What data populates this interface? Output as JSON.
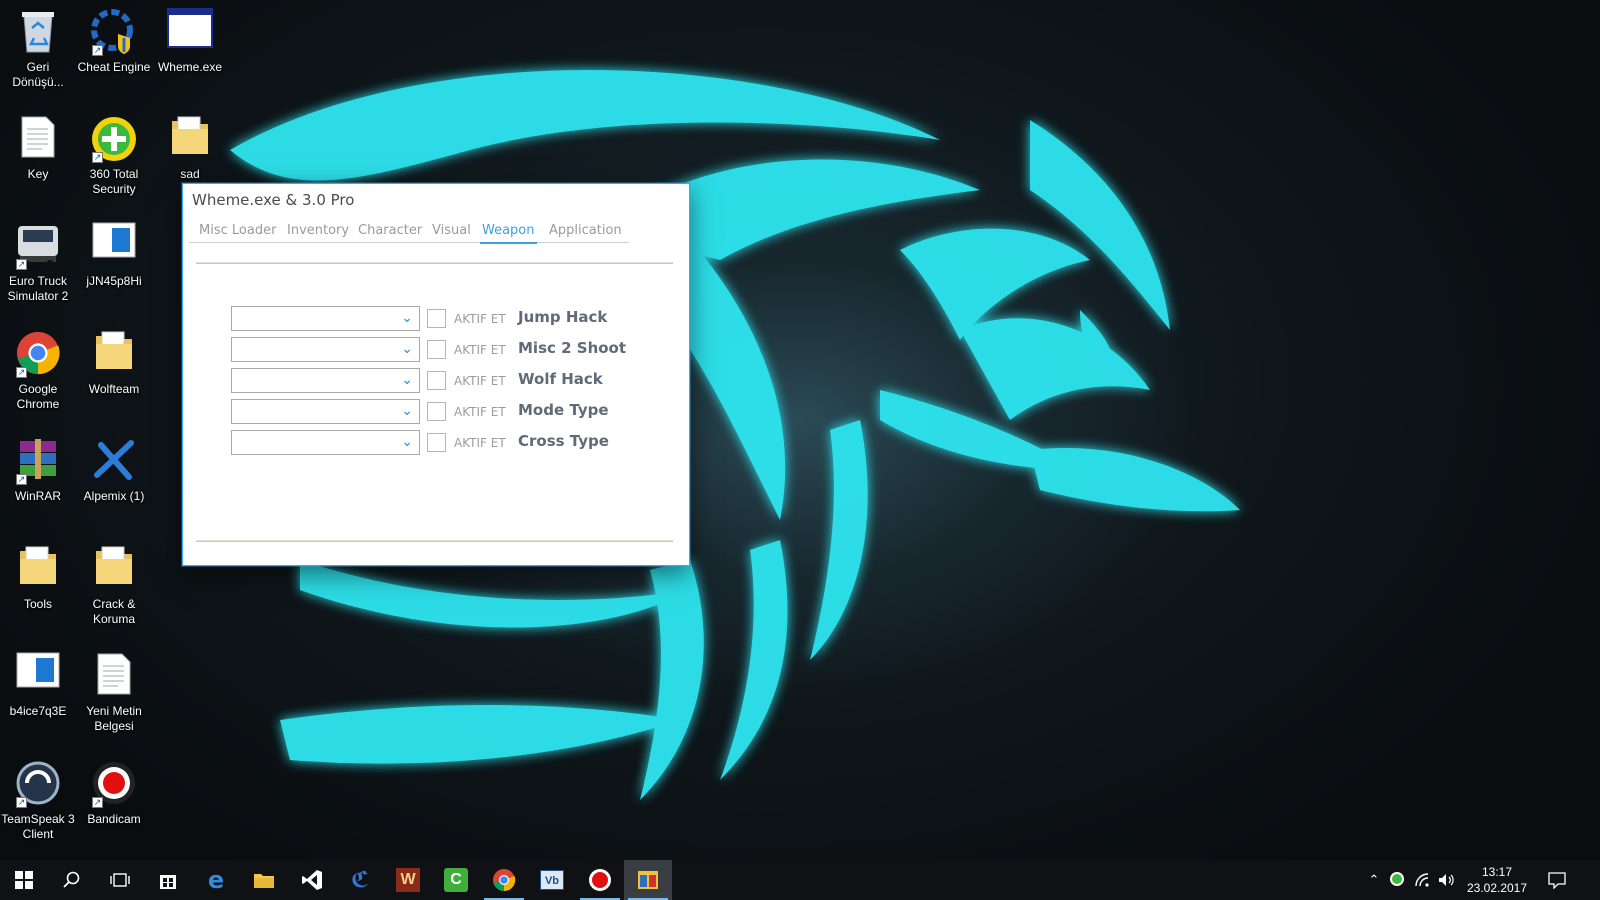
{
  "desktop": {
    "icons": [
      {
        "label": "Geri Dönüşü...",
        "icon": "recycle-bin"
      },
      {
        "label": "Cheat Engine",
        "icon": "cheat-engine"
      },
      {
        "label": "Wheme.exe",
        "icon": "window-app"
      },
      {
        "label": "Key",
        "icon": "text-document"
      },
      {
        "label": "360 Total Security",
        "icon": "360-security"
      },
      {
        "label": "sad",
        "icon": "folder"
      },
      {
        "label": "Euro Truck Simulator 2",
        "icon": "truck"
      },
      {
        "label": "jJN45p8Hi",
        "icon": "image-file"
      },
      {
        "label": "Google Chrome",
        "icon": "chrome"
      },
      {
        "label": "Wolfteam",
        "icon": "folder"
      },
      {
        "label": "WinRAR",
        "icon": "winrar"
      },
      {
        "label": "Alpemix (1)",
        "icon": "alpemix"
      },
      {
        "label": "Tools",
        "icon": "folder"
      },
      {
        "label": "Crack & Koruma",
        "icon": "folder"
      },
      {
        "label": "b4ice7q3E",
        "icon": "image-file"
      },
      {
        "label": "Yeni Metin Belgesi",
        "icon": "text-document"
      },
      {
        "label": "TeamSpeak 3 Client",
        "icon": "teamspeak"
      },
      {
        "label": "Bandicam",
        "icon": "bandicam"
      }
    ]
  },
  "app": {
    "title": "Wheme.exe & 3.0 Pro",
    "tabs": [
      "Misc Loader",
      "Inventory",
      "Character",
      "Visual",
      "Weapon",
      "Application"
    ],
    "active_tab": "Weapon",
    "checkbox_label": "AKTIF ET",
    "features": [
      "Jump Hack",
      "Misc 2 Shoot",
      "Wolf Hack",
      "Mode Type",
      "Cross Type"
    ],
    "accent_color": "#3f9fd9"
  },
  "taskbar": {
    "apps": [
      "start",
      "search",
      "task-view",
      "store",
      "edge",
      "file-explorer",
      "visual-studio",
      "cheat-engine",
      "wolfteam",
      "camtasia",
      "chrome",
      "virtualbox",
      "bandicam",
      "wheme"
    ],
    "clock": {
      "time": "13:17",
      "date": "23.02.2017"
    }
  }
}
